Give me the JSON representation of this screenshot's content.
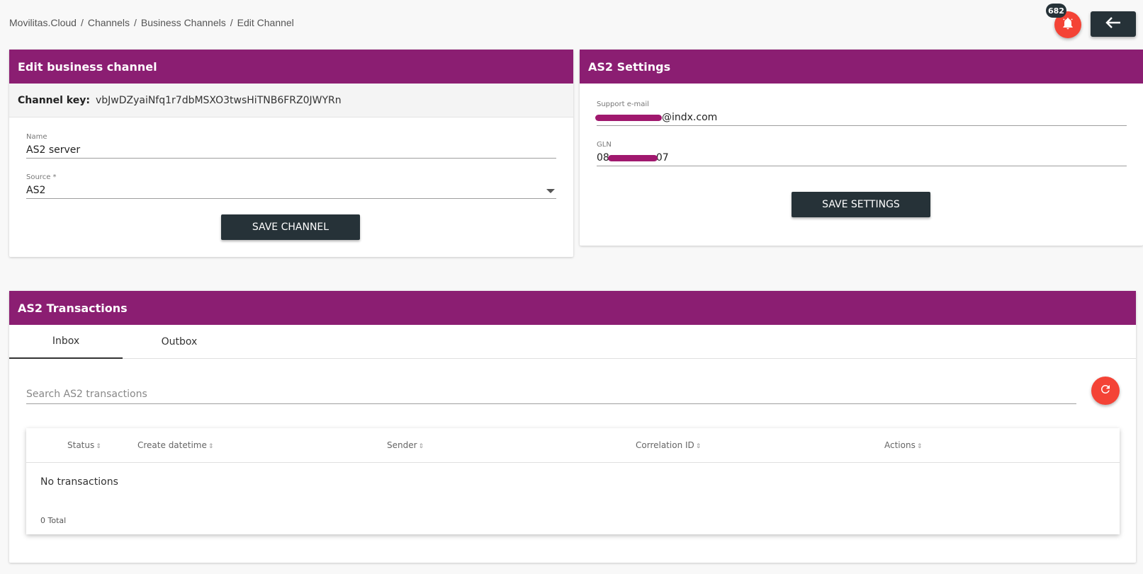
{
  "breadcrumb": [
    "Movilitas.Cloud",
    "Channels",
    "Business Channels",
    "Edit Channel"
  ],
  "header": {
    "notification_count": "682",
    "notification_icon": "bell-icon",
    "back_icon": "arrow-left-icon"
  },
  "edit_channel": {
    "title": "Edit business channel",
    "key_label": "Channel key:",
    "key_value": "vbJwDZyaiNfq1r7dbMSXO3twsHiTNB6FRZ0JWYRn",
    "name_label": "Name",
    "name_value": "AS2 server",
    "source_label": "Source *",
    "source_value": "AS2",
    "save_label": "SAVE CHANNEL"
  },
  "as2_settings": {
    "title": "AS2 Settings",
    "email_label": "Support e-mail",
    "email_value": "@indx.com",
    "gln_label": "GLN",
    "gln_prefix": "08",
    "gln_suffix": "07",
    "save_label": "SAVE SETTINGS"
  },
  "transactions": {
    "title": "AS2 Transactions",
    "tabs": [
      "Inbox",
      "Outbox"
    ],
    "search_placeholder": "Search AS2 transactions",
    "columns": [
      "Status",
      "Create datetime",
      "Sender",
      "Correlation ID",
      "Actions"
    ],
    "empty_message": "No transactions",
    "total": "0 Total"
  },
  "colors": {
    "header": "#8b1e72",
    "dark_button": "#263238",
    "fab": "#f44336"
  }
}
